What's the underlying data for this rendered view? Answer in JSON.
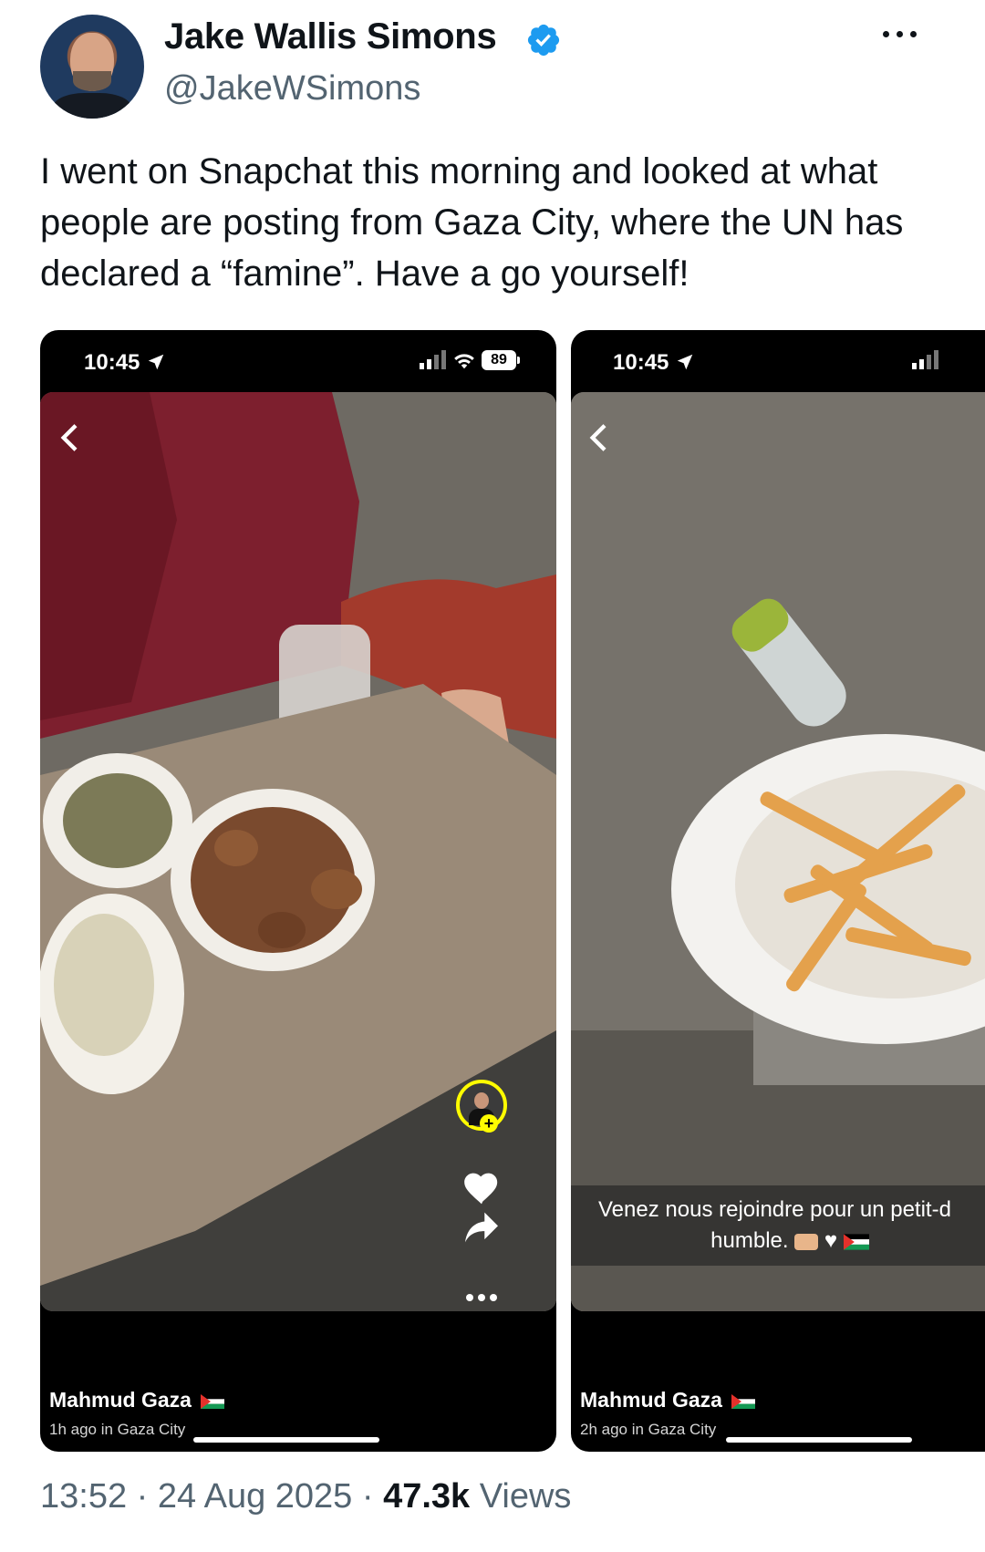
{
  "author": {
    "name": "Jake Wallis Simons",
    "handle": "@JakeWSimons",
    "verified": true,
    "verified_color": "#1d9bf0"
  },
  "tweet": {
    "text": "I went on Snapchat this morning and looked at what people are posting from Gaza City, where the UN has declared a “famine”. Have a go yourself!"
  },
  "media": [
    {
      "status_time": "10:45",
      "battery": "89",
      "author": "Mahmud Gaza",
      "posted": "1h ago in Gaza City"
    },
    {
      "status_time": "10:45",
      "caption_line1": "Venez nous rejoindre pour un petit-d",
      "caption_line2": "humble.",
      "author": "Mahmud Gaza",
      "posted": "2h ago in Gaza City"
    }
  ],
  "footer": {
    "time": "13:52",
    "date": "24 Aug 2025",
    "views_count": "47.3k",
    "views_label": "Views"
  },
  "icons": [
    "verified-icon",
    "more-icon",
    "location-arrow-icon",
    "signal-icon",
    "wifi-icon",
    "battery-icon",
    "back-icon",
    "heart-icon",
    "share-icon",
    "add-friend-icon",
    "palestine-flag-icon"
  ]
}
